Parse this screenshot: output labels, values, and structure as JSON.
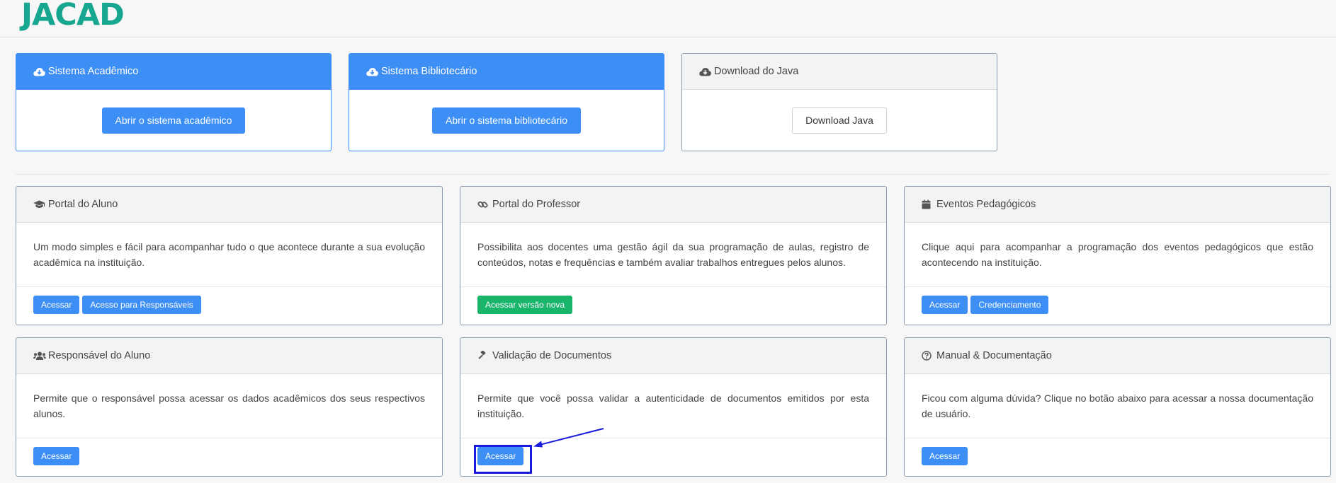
{
  "header": {
    "logo_text": "JACAD"
  },
  "top_cards": [
    {
      "title": "Sistema Acadêmico",
      "icon": "cloud-download-icon",
      "button": "Abrir o sistema acadêmico"
    },
    {
      "title": "Sistema Bibliotecário",
      "icon": "cloud-download-icon",
      "button": "Abrir o sistema bibliotecário"
    },
    {
      "title": "Download do Java",
      "icon": "cloud-download-icon",
      "button": "Download Java"
    }
  ],
  "cards": [
    {
      "title": "Portal do Aluno",
      "icon": "graduation-cap-icon",
      "description": "Um modo simples e fácil para acompanhar tudo o que acontece durante a sua evolução acadêmica na instituição.",
      "buttons": [
        "Acessar",
        "Acesso para Responsáveis"
      ]
    },
    {
      "title": "Portal do Professor",
      "icon": "link-icon",
      "description": "Possibilita aos docentes uma gestão ágil da sua programação de aulas, registro de conteúdos, notas e frequências e também avaliar trabalhos entregues pelos alunos.",
      "buttons": [
        "Acessar versão nova"
      ]
    },
    {
      "title": "Eventos Pedagógicos",
      "icon": "calendar-icon",
      "description": "Clique aqui para acompanhar a programação dos eventos pedagógicos que estão acontecendo na instituição.",
      "buttons": [
        "Acessar",
        "Credenciamento"
      ]
    },
    {
      "title": "Responsável do Aluno",
      "icon": "users-icon",
      "description": "Permite que o responsável possa acessar os dados acadêmicos dos seus respectivos alunos.",
      "buttons": [
        "Acessar"
      ]
    },
    {
      "title": "Validação de Documentos",
      "icon": "gavel-icon",
      "description": "Permite que você possa validar a autenticidade de documentos emitidos por esta instituição.",
      "buttons": [
        "Acessar"
      ]
    },
    {
      "title": "Manual & Documentação",
      "icon": "question-circle-icon",
      "description": "Ficou com alguma dúvida? Clique no botão abaixo para acessar a nossa documentação de usuário.",
      "buttons": [
        "Acessar"
      ]
    }
  ],
  "colors": {
    "primary": "#3d8ef5",
    "success": "#18b56b",
    "brand": "#17a68f",
    "annotation": "#1a1adc"
  }
}
